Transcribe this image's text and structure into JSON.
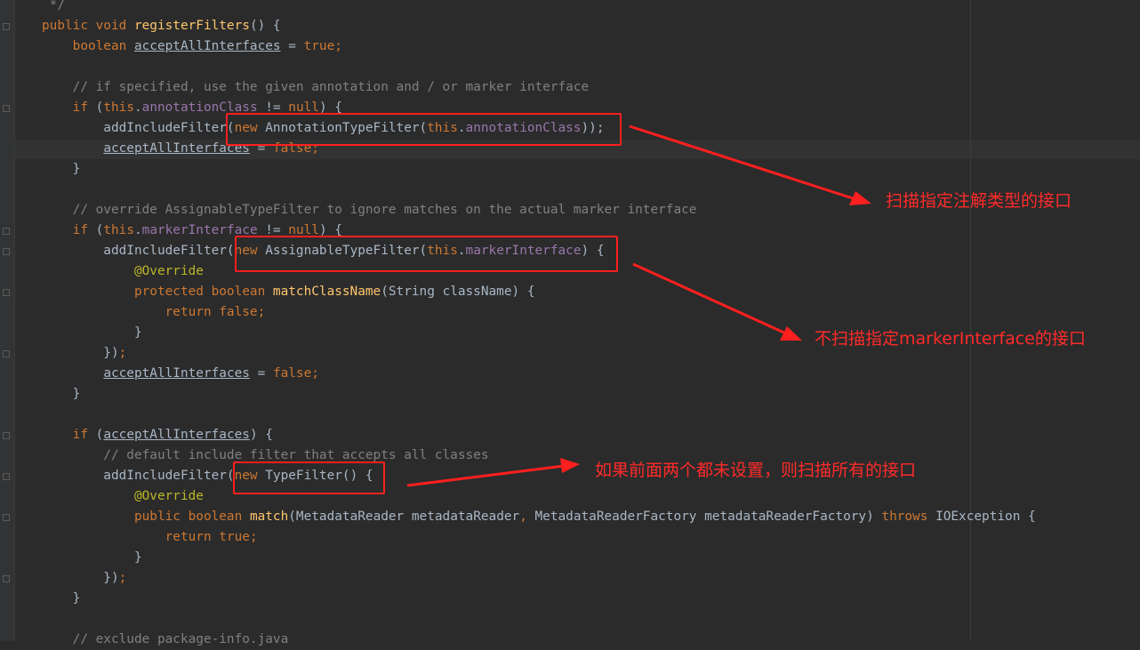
{
  "editor": {
    "lines": [
      [
        {
          "t": " */",
          "c": "cmt"
        }
      ],
      [
        {
          "t": "public void ",
          "c": "kw"
        },
        {
          "t": "registerFilters",
          "c": "fn"
        },
        {
          "t": "() {",
          "c": "plain"
        }
      ],
      [
        {
          "t": "    boolean ",
          "c": "kw"
        },
        {
          "t": "acceptAllInterfaces",
          "c": "plain ul"
        },
        {
          "t": " = ",
          "c": "plain"
        },
        {
          "t": "true",
          "c": "kw"
        },
        {
          "t": ";",
          "c": "kw"
        }
      ],
      [],
      [
        {
          "t": "    // if specified, use the given annotation and / or marker interface",
          "c": "cmt"
        }
      ],
      [
        {
          "t": "    if ",
          "c": "kw"
        },
        {
          "t": "(",
          "c": "plain"
        },
        {
          "t": "this",
          "c": "kw"
        },
        {
          "t": ".",
          "c": "plain"
        },
        {
          "t": "annotationClass",
          "c": "fld"
        },
        {
          "t": " != ",
          "c": "plain"
        },
        {
          "t": "null",
          "c": "kw"
        },
        {
          "t": ") {",
          "c": "plain"
        }
      ],
      [
        {
          "t": "        addIncludeFilter(",
          "c": "plain"
        },
        {
          "t": "new ",
          "c": "kw"
        },
        {
          "t": "AnnotationTypeFilter(",
          "c": "plain"
        },
        {
          "t": "this",
          "c": "kw"
        },
        {
          "t": ".",
          "c": "plain"
        },
        {
          "t": "annotationClass",
          "c": "fld"
        },
        {
          "t": "));",
          "c": "plain"
        }
      ],
      [
        {
          "t": "        ",
          "c": "plain"
        },
        {
          "t": "acceptAllInterfaces",
          "c": "plain ul"
        },
        {
          "t": " = ",
          "c": "plain"
        },
        {
          "t": "false",
          "c": "kw"
        },
        {
          "t": ";",
          "c": "kw"
        }
      ],
      [
        {
          "t": "    }",
          "c": "plain"
        }
      ],
      [],
      [
        {
          "t": "    // override AssignableTypeFilter to ignore matches on the actual marker interface",
          "c": "cmt"
        }
      ],
      [
        {
          "t": "    if ",
          "c": "kw"
        },
        {
          "t": "(",
          "c": "plain"
        },
        {
          "t": "this",
          "c": "kw"
        },
        {
          "t": ".",
          "c": "plain"
        },
        {
          "t": "markerInterface",
          "c": "fld"
        },
        {
          "t": " != ",
          "c": "plain"
        },
        {
          "t": "null",
          "c": "kw"
        },
        {
          "t": ") {",
          "c": "plain"
        }
      ],
      [
        {
          "t": "        addIncludeFilter(",
          "c": "plain"
        },
        {
          "t": "new ",
          "c": "kw"
        },
        {
          "t": "AssignableTypeFilter(",
          "c": "plain"
        },
        {
          "t": "this",
          "c": "kw"
        },
        {
          "t": ".",
          "c": "plain"
        },
        {
          "t": "markerInterface",
          "c": "fld"
        },
        {
          "t": ") {",
          "c": "plain"
        }
      ],
      [
        {
          "t": "            @Override",
          "c": "ann"
        }
      ],
      [
        {
          "t": "            protected boolean ",
          "c": "kw"
        },
        {
          "t": "matchClassName",
          "c": "fn"
        },
        {
          "t": "(String className) {",
          "c": "plain"
        }
      ],
      [
        {
          "t": "                return false",
          "c": "kw"
        },
        {
          "t": ";",
          "c": "kw"
        }
      ],
      [
        {
          "t": "            }",
          "c": "plain"
        }
      ],
      [
        {
          "t": "        })",
          "c": "plain"
        },
        {
          "t": ";",
          "c": "kw"
        }
      ],
      [
        {
          "t": "        ",
          "c": "plain"
        },
        {
          "t": "acceptAllInterfaces",
          "c": "plain ul"
        },
        {
          "t": " = ",
          "c": "plain"
        },
        {
          "t": "false",
          "c": "kw"
        },
        {
          "t": ";",
          "c": "kw"
        }
      ],
      [
        {
          "t": "    }",
          "c": "plain"
        }
      ],
      [],
      [
        {
          "t": "    if ",
          "c": "kw"
        },
        {
          "t": "(",
          "c": "plain"
        },
        {
          "t": "acceptAllInterfaces",
          "c": "plain ul"
        },
        {
          "t": ") {",
          "c": "plain"
        }
      ],
      [
        {
          "t": "        // default include filter that accepts all classes",
          "c": "cmt"
        }
      ],
      [
        {
          "t": "        addIncludeFilter(",
          "c": "plain"
        },
        {
          "t": "new ",
          "c": "kw"
        },
        {
          "t": "TypeFilter() {",
          "c": "plain"
        }
      ],
      [
        {
          "t": "            @Override",
          "c": "ann"
        }
      ],
      [
        {
          "t": "            public boolean ",
          "c": "kw"
        },
        {
          "t": "match",
          "c": "fn"
        },
        {
          "t": "(MetadataReader metadataReader",
          "c": "plain"
        },
        {
          "t": ", ",
          "c": "kw"
        },
        {
          "t": "MetadataReaderFactory metadataReaderFactory) ",
          "c": "plain"
        },
        {
          "t": "throws ",
          "c": "kw"
        },
        {
          "t": "IOException {",
          "c": "plain"
        }
      ],
      [
        {
          "t": "                return true",
          "c": "kw"
        },
        {
          "t": ";",
          "c": "kw"
        }
      ],
      [
        {
          "t": "            }",
          "c": "plain"
        }
      ],
      [
        {
          "t": "        })",
          "c": "plain"
        },
        {
          "t": ";",
          "c": "kw"
        }
      ],
      [
        {
          "t": "    }",
          "c": "plain"
        }
      ],
      [],
      [
        {
          "t": "    // exclude package-info.java",
          "c": "cmt"
        }
      ]
    ]
  },
  "annotations": {
    "note1": "扫描指定注解类型的接口",
    "note2": "不扫描指定markerInterface的接口",
    "note3": "如果前面两个都未设置，则扫描所有的接口"
  },
  "colors": {
    "background": "#2b2b2b",
    "keyword": "#cc7832",
    "field": "#9876aa",
    "method": "#ffc66d",
    "annotation": "#bbb529",
    "comment": "#808080",
    "text": "#a9b7c6",
    "highlight": "#ff1f1f"
  }
}
